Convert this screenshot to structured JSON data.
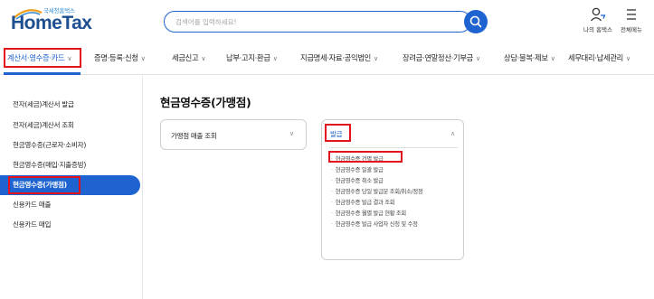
{
  "header": {
    "logo_sub": "국세청홈택스",
    "logo_main": "HomeTax",
    "search_placeholder": "검색어를 입력하세요!",
    "my_hometax_label": "나의 홈택스",
    "all_menu_label": "전체메뉴"
  },
  "gnb": {
    "items": [
      {
        "label": "계산서·영수증·카드",
        "active": true
      },
      {
        "label": "증명·등록·신청"
      },
      {
        "label": "세금신고"
      },
      {
        "label": "납부·고지·환급"
      },
      {
        "label": "지급명세·자료·공익법인"
      },
      {
        "label": "장려금·연말정산·기부금"
      },
      {
        "label": "상담·불복·제보"
      },
      {
        "label": "세무대리·납세관리"
      }
    ]
  },
  "sidebar": {
    "items": [
      {
        "label": "전자(세금)계산서 발급"
      },
      {
        "label": "전자(세금)계산서 조회"
      },
      {
        "label": "현금영수증(근로자·소비자)"
      },
      {
        "label": "현금영수증(매입·지출증빙)"
      },
      {
        "label": "현금영수증(가맹점)",
        "active": true
      },
      {
        "label": "신용카드 매출"
      },
      {
        "label": "신용카드 매입"
      }
    ]
  },
  "main": {
    "page_title": "현금영수증(가맹점)",
    "card1_label": "가맹점 매출 조회",
    "card2_label": "발급",
    "card2_items": [
      {
        "label": "현금영수증 건별 발급"
      },
      {
        "label": "현금영수증 일괄 발급"
      },
      {
        "label": "현금영수증 취소 발급"
      },
      {
        "label": "현금영수증 당일 발급분 조회/취소/정정"
      },
      {
        "label": "현금영수증 발급 결과 조회"
      },
      {
        "label": "현금영수증 월별 발급 현황 조회"
      },
      {
        "label": "현금영수증 발급 사업자 신청 및 수정"
      }
    ]
  },
  "colors": {
    "accent": "#1e63d0",
    "highlight": "#e2131a",
    "logo": "#1d4f91"
  },
  "icons": [
    "search-icon",
    "user-icon",
    "menu-icon",
    "chevron-down-icon",
    "chevron-up-icon"
  ]
}
